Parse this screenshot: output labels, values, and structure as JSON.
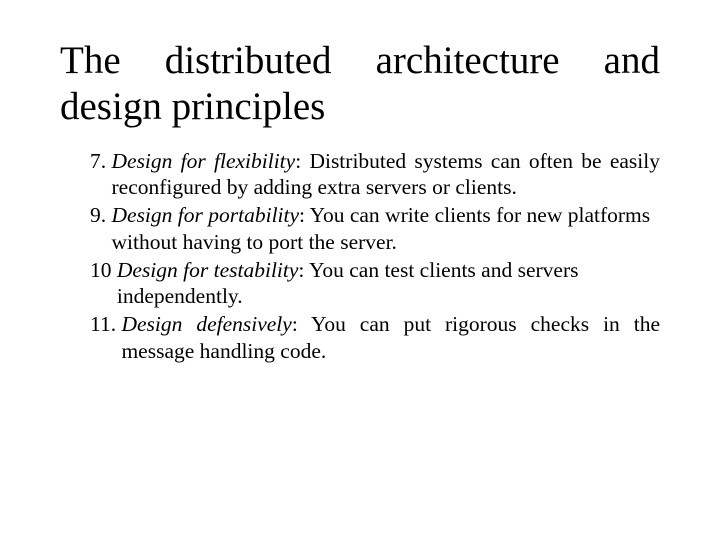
{
  "title": "The distributed architecture and design principles",
  "items": [
    {
      "num": "7. ",
      "label": "Design for flexibility",
      "sep": ": ",
      "body": "Distributed systems can often be easily reconfigured by adding extra servers or clients.",
      "justify": true
    },
    {
      "num": "9. ",
      "label": "Design for portability",
      "sep": ": ",
      "body": "You can write clients for new platforms without having to port the server.",
      "justify": false
    },
    {
      "num": "10 ",
      "label": "Design for testability",
      "sep": ": ",
      "body": "You can test clients and servers independently.",
      "justify": false
    },
    {
      "num": "11. ",
      "label": "Design defensively",
      "sep": ": ",
      "body": "You can put rigorous checks in the message handling code.",
      "justify": true
    }
  ]
}
